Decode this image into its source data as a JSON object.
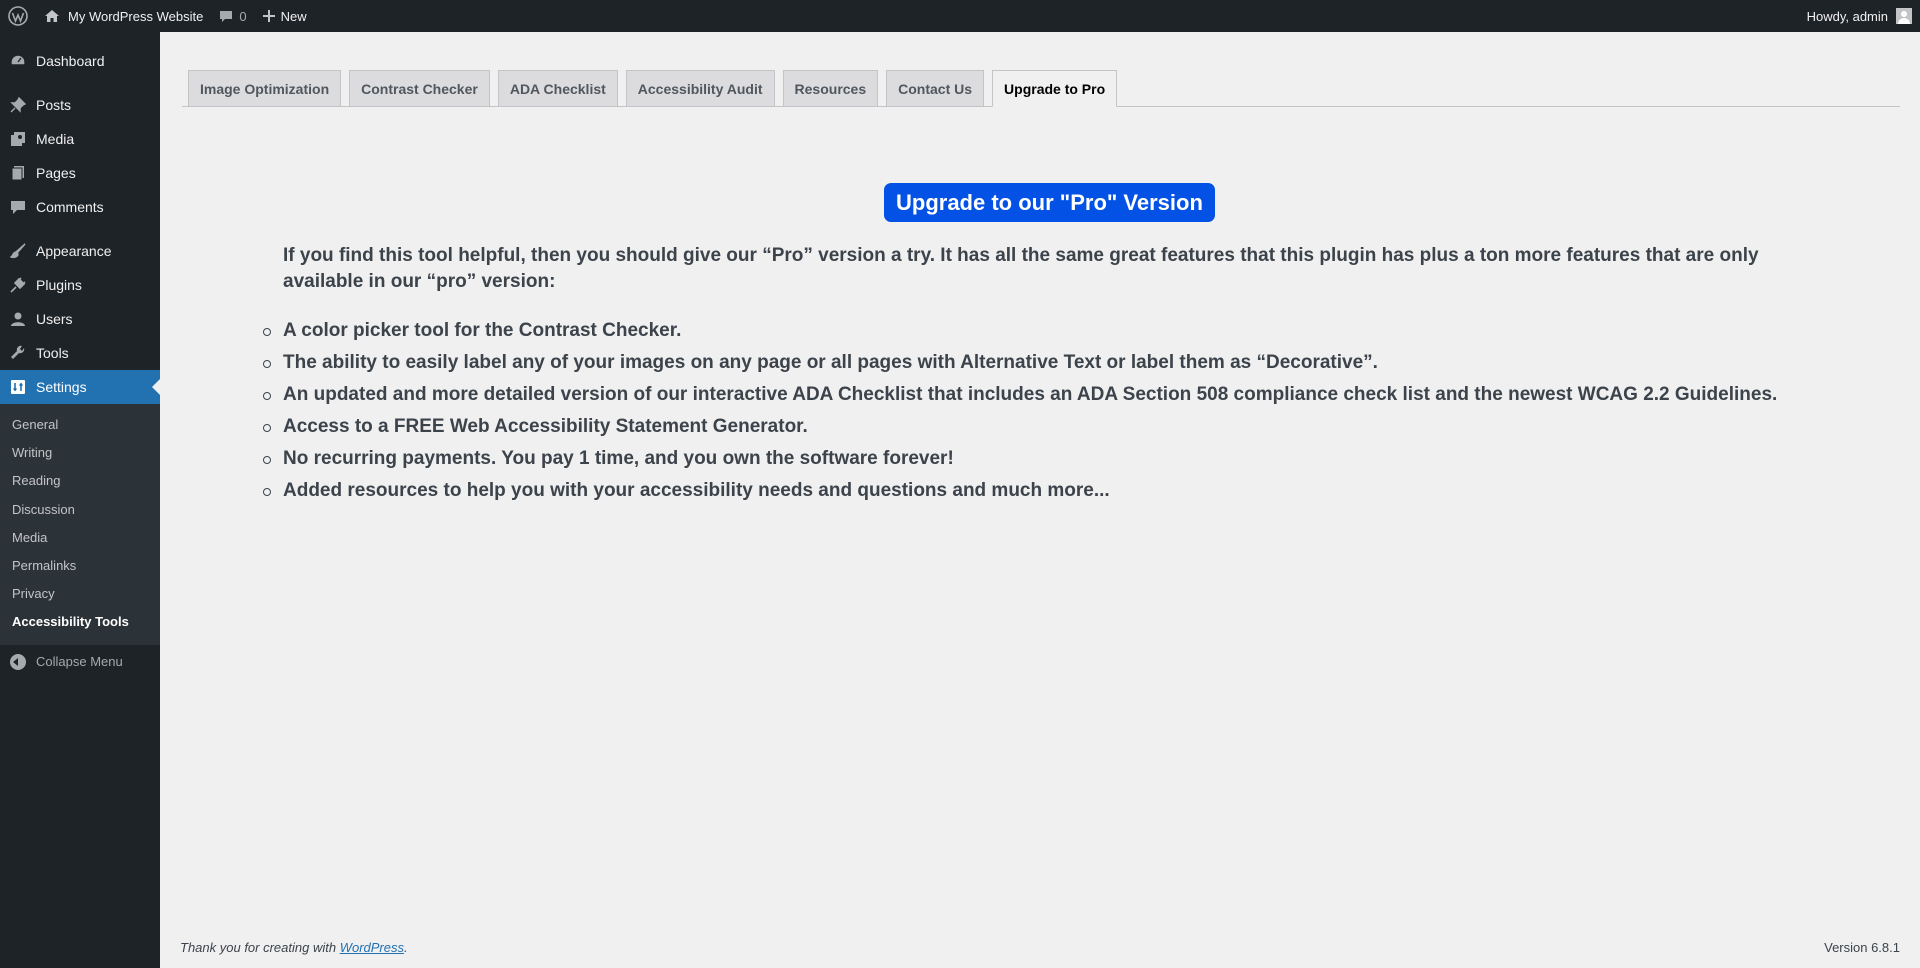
{
  "adminbar": {
    "site_name": "My WordPress Website",
    "comments_count": "0",
    "new_label": "New",
    "greeting": "Howdy, admin"
  },
  "sidebar": {
    "items": [
      {
        "label": "Dashboard",
        "icon": "dashboard-icon"
      },
      {
        "label": "Posts",
        "icon": "pin-icon"
      },
      {
        "label": "Media",
        "icon": "media-icon"
      },
      {
        "label": "Pages",
        "icon": "pages-icon"
      },
      {
        "label": "Comments",
        "icon": "comment-icon"
      },
      {
        "label": "Appearance",
        "icon": "brush-icon"
      },
      {
        "label": "Plugins",
        "icon": "plug-icon"
      },
      {
        "label": "Users",
        "icon": "user-icon"
      },
      {
        "label": "Tools",
        "icon": "wrench-icon"
      },
      {
        "label": "Settings",
        "icon": "settings-icon"
      }
    ],
    "submenu": [
      "General",
      "Writing",
      "Reading",
      "Discussion",
      "Media",
      "Permalinks",
      "Privacy",
      "Accessibility Tools"
    ],
    "collapse_label": "Collapse Menu"
  },
  "tabs": [
    "Image Optimization",
    "Contrast Checker",
    "ADA Checklist",
    "Accessibility Audit",
    "Resources",
    "Contact Us",
    "Upgrade to Pro"
  ],
  "main": {
    "cta_label": "Upgrade to our \"Pro\" Version",
    "intro": "If you find this tool helpful, then you should give our “Pro” version a try. It has all the same great features that this plugin has plus a ton more features that are only available in our “pro” version:",
    "features": [
      "A color picker tool for the Contrast Checker.",
      "The ability to easily label any of your images on any page or all pages with Alternative Text or label them as “Decorative”.",
      "An updated and more detailed version of our interactive ADA Checklist that includes an ADA Section 508 compliance check list and the newest WCAG 2.2 Guidelines.",
      "Access to a FREE Web Accessibility Statement Generator.",
      "No recurring payments. You pay 1 time, and you own the software forever!",
      "Added resources to help you with your accessibility needs and questions and much more..."
    ]
  },
  "footer": {
    "thanks_prefix": "Thank you for creating with ",
    "thanks_link": "WordPress",
    "thanks_suffix": ".",
    "version": "Version 6.8.1"
  },
  "colors": {
    "admin_dark": "#1d2327",
    "accent": "#2271b1",
    "cta": "#0451e5",
    "background": "#f0f0f1"
  }
}
